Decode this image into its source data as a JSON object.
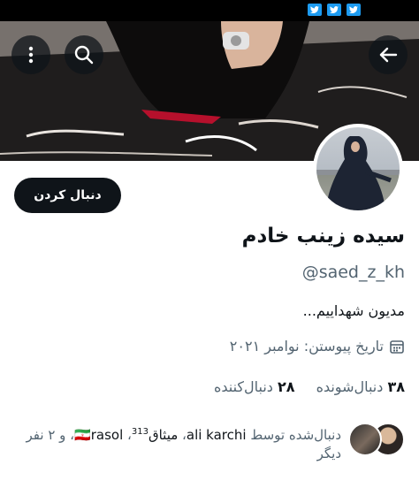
{
  "colors": {
    "accent": "#1d9bf0",
    "text": "#0f1419",
    "secondary": "#536471",
    "button_bg": "#0f1419"
  },
  "toolbar": {
    "back_icon": "arrow-left-icon",
    "search_icon": "search-icon",
    "more_icon": "more-vertical-icon"
  },
  "profile": {
    "follow_label": "دنبال کردن",
    "display_name": "سیده زینب خادم",
    "handle": "@saed_z_kh",
    "bio": "مدیون شهداییم...",
    "joined": "تاریخ پیوستن: نوامبر ۲۰۲۱",
    "following_count": "۲۸",
    "following_label": "دنبال‌کننده",
    "followers_count": "۳۸",
    "followers_label": "دنبال‌شونده"
  },
  "followed_by": {
    "prefix": "دنبال‌شده توسط",
    "name1": "ali karchi",
    "sep1": "،",
    "name2": "میثاق",
    "sup": "313",
    "sep2": "،",
    "name3": "rasol",
    "flag": "🇮🇷",
    "suffix": "، و ۲ نفر دیگر"
  }
}
